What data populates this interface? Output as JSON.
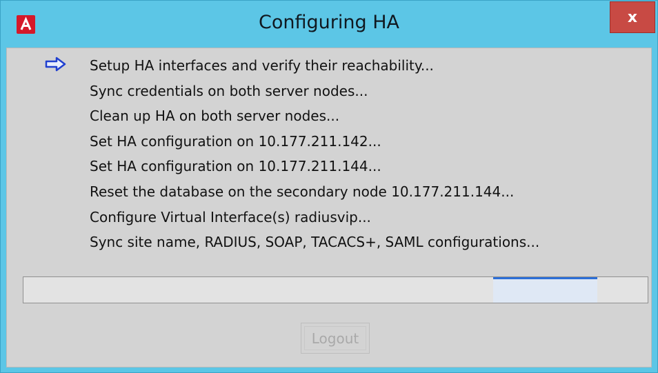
{
  "window": {
    "title": "Configuring HA",
    "app_icon": "A",
    "close_label": "x"
  },
  "steps": {
    "current_icon": "right-arrow-icon",
    "items": [
      "Setup HA interfaces and verify their reachability...",
      "Sync credentials on both server nodes...",
      "Clean up HA on both server nodes...",
      "Set HA configuration on 10.177.211.142...",
      "Set HA configuration on 10.177.211.144...",
      "Reset the database on the secondary node 10.177.211.144...",
      "Configure Virtual Interface(s) radiusvip...",
      "Sync site name, RADIUS, SOAP, TACACS+, SAML configurations..."
    ]
  },
  "progress": {
    "indeterminate": true,
    "fill_color": "#2c6fd8"
  },
  "footer": {
    "logout_label": "Logout",
    "logout_enabled": false
  },
  "colors": {
    "title_bar": "#5cc6e6",
    "close_button": "#c84a44",
    "app_icon": "#d5192a",
    "client_bg": "#d3d3d3"
  }
}
